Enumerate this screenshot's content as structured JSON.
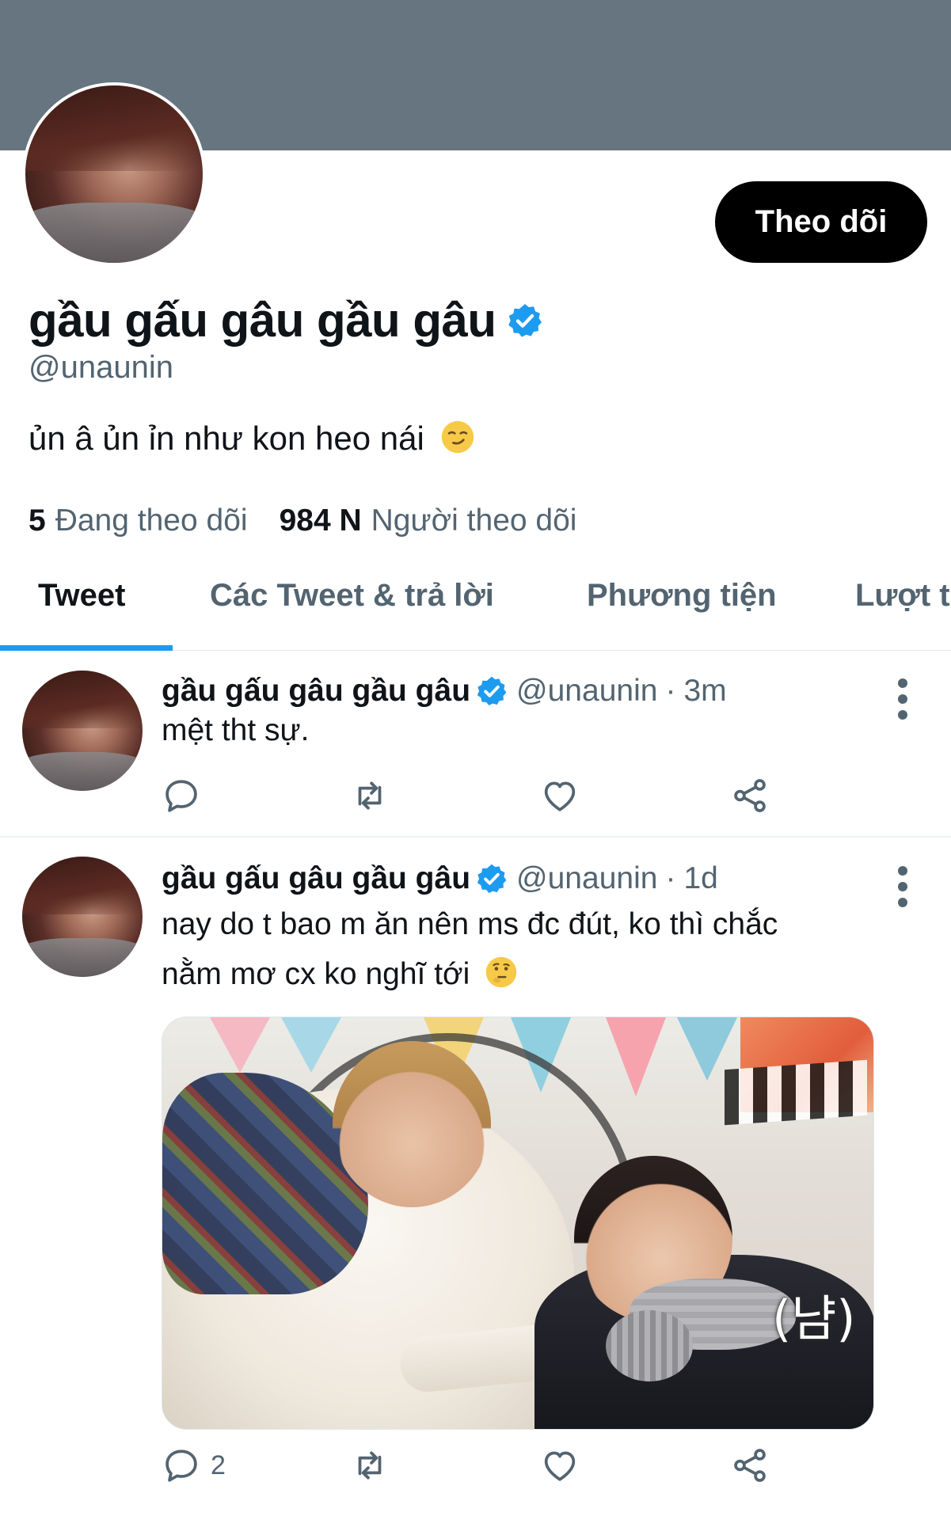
{
  "profile": {
    "display_name": "gầu gấu gâu gầu gâu",
    "handle": "@unaunin",
    "bio": "ủn â ủn ỉn như kon heo nái",
    "follow_button": "Theo dõi",
    "following_count": "5",
    "following_label": "Đang theo dõi",
    "followers_count": "984 N",
    "followers_label": "Người theo dõi"
  },
  "tabs": [
    {
      "label": "Tweet",
      "active": true
    },
    {
      "label": "Các Tweet & trả lời",
      "active": false
    },
    {
      "label": "Phương tiện",
      "active": false
    },
    {
      "label": "Lượt t",
      "active": false
    }
  ],
  "tweets": [
    {
      "name": "gầu gấu gâu gầu gâu",
      "handle": "@unaunin",
      "dot": "·",
      "time": "3m",
      "text": "mệt tht sự.",
      "reply_count": ""
    },
    {
      "name": "gầu gấu gâu gầu gâu",
      "handle": "@unaunin",
      "dot": "·",
      "time": "1d",
      "text_line1": "nay do t bao m ăn nên ms đc đút, ko thì chắc",
      "text_line2": "nằm mơ cx ko nghĩ tới",
      "media_caption": "(냠)",
      "reply_count": "2"
    }
  ],
  "colors": {
    "banner": "#66757f",
    "accent": "#1d9bf0",
    "secondary_text": "#536471"
  },
  "icons": {
    "verified": "verified-badge-icon",
    "reply": "reply-icon",
    "retweet": "retweet-icon",
    "like": "heart-icon",
    "share": "share-icon",
    "more": "more-vertical-icon"
  }
}
